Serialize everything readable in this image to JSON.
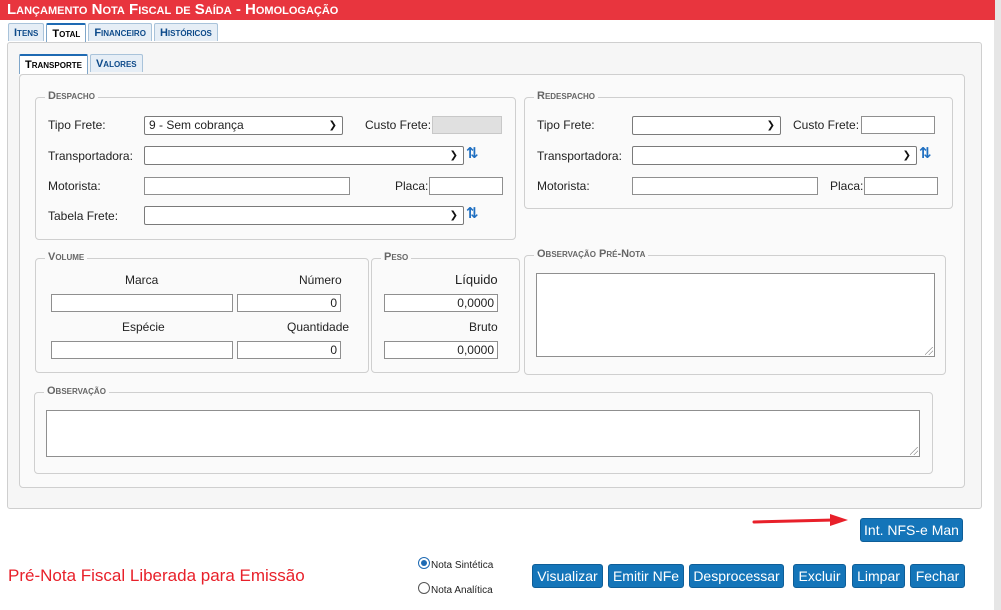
{
  "window": {
    "title": "Lançamento Nota Fiscal de Saída  - Homologação"
  },
  "main_tabs": [
    {
      "label": "Itens",
      "active": false
    },
    {
      "label": "Total",
      "active": true
    },
    {
      "label": "Financeiro",
      "active": false
    },
    {
      "label": "Históricos",
      "active": false
    }
  ],
  "sub_tabs": [
    {
      "label": "Transporte",
      "active": true
    },
    {
      "label": "Valores",
      "active": false
    }
  ],
  "despacho": {
    "legend": "Despacho",
    "tipo_frete_label": "Tipo Frete:",
    "tipo_frete_value": "9 - Sem cobrança",
    "custo_frete_label": "Custo Frete:",
    "custo_frete_value": "",
    "transportadora_label": "Transportadora:",
    "transportadora_value": "",
    "motorista_label": "Motorista:",
    "motorista_value": "",
    "placa_label": "Placa:",
    "placa_value": "",
    "tabela_frete_label": "Tabela Frete:",
    "tabela_frete_value": ""
  },
  "redespacho": {
    "legend": "Redespacho",
    "tipo_frete_label": "Tipo Frete:",
    "tipo_frete_value": "",
    "custo_frete_label": "Custo Frete:",
    "custo_frete_value": "",
    "transportadora_label": "Transportadora:",
    "transportadora_value": "",
    "motorista_label": "Motorista:",
    "motorista_value": "",
    "placa_label": "Placa:",
    "placa_value": ""
  },
  "volume": {
    "legend": "Volume",
    "marca_label": "Marca",
    "marca_value": "",
    "numero_label": "Número",
    "numero_value": "0",
    "especie_label": "Espécie",
    "especie_value": "",
    "quantidade_label": "Quantidade",
    "quantidade_value": "0"
  },
  "peso": {
    "legend": "Peso",
    "liquido_label": "Líquido",
    "liquido_value": "0,0000",
    "bruto_label": "Bruto",
    "bruto_value": "0,0000"
  },
  "observacao_pre_nota": {
    "legend": "Observação Pré-Nota",
    "value": ""
  },
  "observacao": {
    "legend": "Observação",
    "value": ""
  },
  "actions": {
    "int_nfse_man": "Int. NFS-e Man",
    "visualizar": "Visualizar",
    "emitir_nfe": "Emitir NFe",
    "desprocessar": "Desprocessar",
    "excluir": "Excluir",
    "limpar": "Limpar",
    "fechar": "Fechar"
  },
  "status_text": "Pré-Nota Fiscal Liberada para Emissão",
  "report_options": {
    "sintetica_label": "Nota Sintética",
    "analitica_label": "Nota Analítica",
    "selected": "Nota Sintética"
  },
  "colors": {
    "title_bar": "#e8353e",
    "button": "#1475b9",
    "status_text": "#e8202a",
    "arrow": "#e8202a"
  },
  "icons": {
    "refresh": "refresh-icon",
    "arrow": "arrow-right-icon"
  }
}
